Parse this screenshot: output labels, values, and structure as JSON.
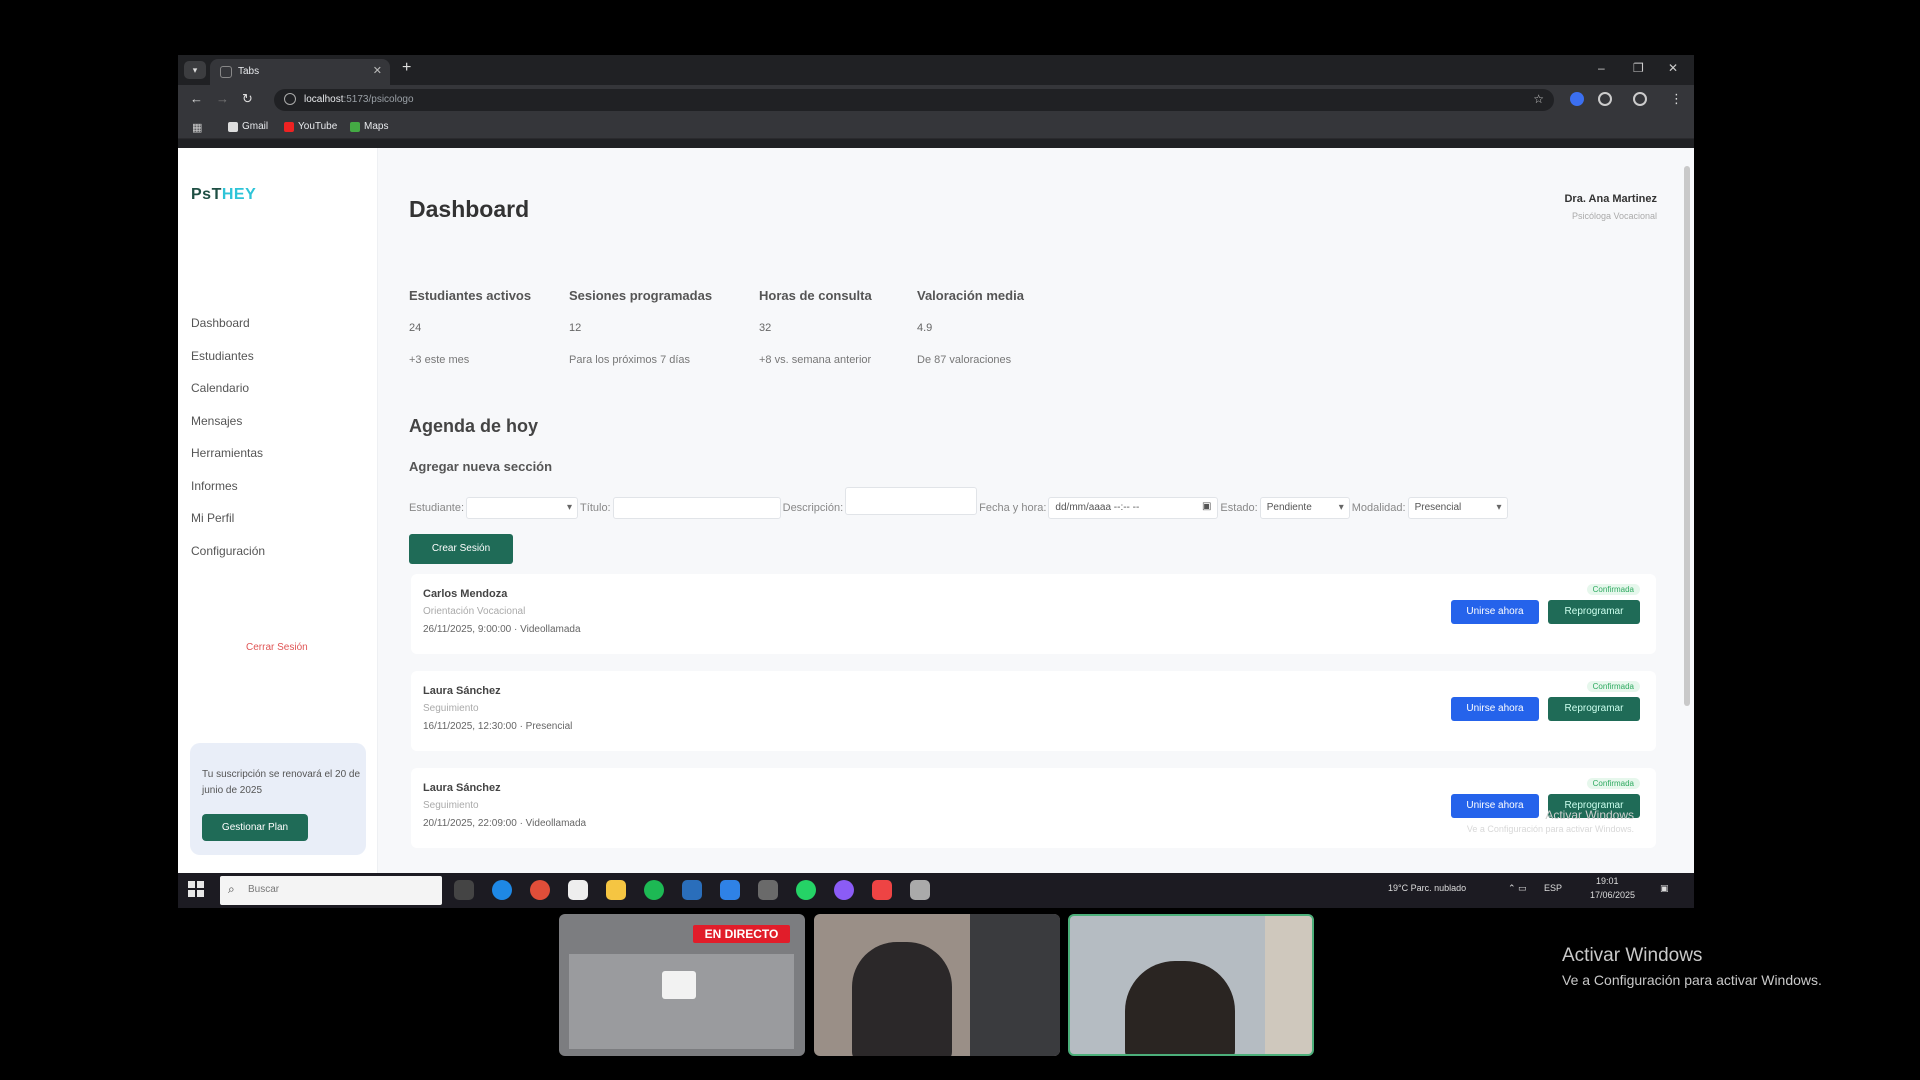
{
  "browser": {
    "tab_title": "Tabs",
    "url_host": "localhost",
    "url_path": ":5173/psicologo",
    "bookmarks": [
      "Gmail",
      "YouTube",
      "Maps"
    ]
  },
  "sidebar": {
    "logo_main": "PsT",
    "logo_accent": "HEY",
    "items": [
      {
        "label": "Dashboard"
      },
      {
        "label": "Estudiantes"
      },
      {
        "label": "Calendario"
      },
      {
        "label": "Mensajes"
      },
      {
        "label": "Herramientas"
      },
      {
        "label": "Informes"
      },
      {
        "label": "Mi Perfil"
      },
      {
        "label": "Configuración"
      }
    ],
    "logout": "Cerrar Sesión",
    "subscription_text": "Tu suscripción se renovará el 20 de junio de 2025",
    "subscription_button": "Gestionar Plan"
  },
  "header": {
    "title": "Dashboard",
    "user_name": "Dra. Ana Martinez",
    "user_role": "Psicóloga Vocacional"
  },
  "stats": [
    {
      "label": "Estudiantes activos",
      "value": "24",
      "sub": "+3 este mes"
    },
    {
      "label": "Sesiones programadas",
      "value": "12",
      "sub": "Para los próximos 7 días"
    },
    {
      "label": "Horas de consulta",
      "value": "32",
      "sub": "+8 vs. semana anterior"
    },
    {
      "label": "Valoración media",
      "value": "4.9",
      "sub": "De 87 valoraciones"
    }
  ],
  "agenda": {
    "title": "Agenda de hoy",
    "new_section_title": "Agregar nueva sección",
    "form": {
      "student_label": "Estudiante:",
      "title_label": "Título:",
      "description_label": "Descripción:",
      "datetime_label": "Fecha y hora:",
      "datetime_placeholder": "dd/mm/aaaa --:-- --",
      "status_label": "Estado:",
      "status_value": "Pendiente",
      "modality_label": "Modalidad:",
      "modality_value": "Presencial",
      "create_button": "Crear Sesión"
    },
    "sessions": [
      {
        "name": "Carlos Mendoza",
        "type": "Orientación Vocacional",
        "meta": "26/11/2025, 9:00:00 · Videollamada",
        "status": "Confirmada",
        "join": "Unirse ahora",
        "reschedule": "Reprogramar"
      },
      {
        "name": "Laura Sánchez",
        "type": "Seguimiento",
        "meta": "16/11/2025, 12:30:00 · Presencial",
        "status": "Confirmada",
        "join": "Unirse ahora",
        "reschedule": "Reprogramar"
      },
      {
        "name": "Laura Sánchez",
        "type": "Seguimiento",
        "meta": "20/11/2025, 22:09:00 · Videollamada",
        "status": "Confirmada",
        "join": "Unirse ahora",
        "reschedule": "Reprogramar"
      }
    ]
  },
  "taskbar": {
    "search_placeholder": "Buscar",
    "weather": "19°C  Parc. nublado",
    "lang": "ESP",
    "time": "19:01",
    "date": "17/06/2025"
  },
  "meeting": {
    "live_badge": "EN DIRECTO"
  },
  "watermark": {
    "title": "Activar Windows",
    "subtitle": "Ve a Configuración para activar Windows."
  }
}
